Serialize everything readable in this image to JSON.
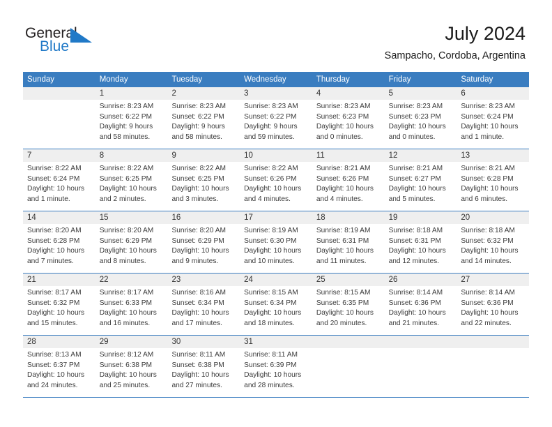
{
  "brand": {
    "name_part1": "General",
    "name_part2": "Blue",
    "accent_color": "#2079c7",
    "triangle_color": "#2079c7"
  },
  "header": {
    "title": "July 2024",
    "location": "Sampacho, Cordoba, Argentina"
  },
  "calendar": {
    "header_bg": "#3a7dc0",
    "daynum_bg": "#efefef",
    "weekday_names": [
      "Sunday",
      "Monday",
      "Tuesday",
      "Wednesday",
      "Thursday",
      "Friday",
      "Saturday"
    ],
    "weeks": [
      {
        "days": [
          {
            "num": "",
            "lines": []
          },
          {
            "num": "1",
            "lines": [
              "Sunrise: 8:23 AM",
              "Sunset: 6:22 PM",
              "Daylight: 9 hours",
              "and 58 minutes."
            ]
          },
          {
            "num": "2",
            "lines": [
              "Sunrise: 8:23 AM",
              "Sunset: 6:22 PM",
              "Daylight: 9 hours",
              "and 58 minutes."
            ]
          },
          {
            "num": "3",
            "lines": [
              "Sunrise: 8:23 AM",
              "Sunset: 6:22 PM",
              "Daylight: 9 hours",
              "and 59 minutes."
            ]
          },
          {
            "num": "4",
            "lines": [
              "Sunrise: 8:23 AM",
              "Sunset: 6:23 PM",
              "Daylight: 10 hours",
              "and 0 minutes."
            ]
          },
          {
            "num": "5",
            "lines": [
              "Sunrise: 8:23 AM",
              "Sunset: 6:23 PM",
              "Daylight: 10 hours",
              "and 0 minutes."
            ]
          },
          {
            "num": "6",
            "lines": [
              "Sunrise: 8:23 AM",
              "Sunset: 6:24 PM",
              "Daylight: 10 hours",
              "and 1 minute."
            ]
          }
        ]
      },
      {
        "days": [
          {
            "num": "7",
            "lines": [
              "Sunrise: 8:22 AM",
              "Sunset: 6:24 PM",
              "Daylight: 10 hours",
              "and 1 minute."
            ]
          },
          {
            "num": "8",
            "lines": [
              "Sunrise: 8:22 AM",
              "Sunset: 6:25 PM",
              "Daylight: 10 hours",
              "and 2 minutes."
            ]
          },
          {
            "num": "9",
            "lines": [
              "Sunrise: 8:22 AM",
              "Sunset: 6:25 PM",
              "Daylight: 10 hours",
              "and 3 minutes."
            ]
          },
          {
            "num": "10",
            "lines": [
              "Sunrise: 8:22 AM",
              "Sunset: 6:26 PM",
              "Daylight: 10 hours",
              "and 4 minutes."
            ]
          },
          {
            "num": "11",
            "lines": [
              "Sunrise: 8:21 AM",
              "Sunset: 6:26 PM",
              "Daylight: 10 hours",
              "and 4 minutes."
            ]
          },
          {
            "num": "12",
            "lines": [
              "Sunrise: 8:21 AM",
              "Sunset: 6:27 PM",
              "Daylight: 10 hours",
              "and 5 minutes."
            ]
          },
          {
            "num": "13",
            "lines": [
              "Sunrise: 8:21 AM",
              "Sunset: 6:28 PM",
              "Daylight: 10 hours",
              "and 6 minutes."
            ]
          }
        ]
      },
      {
        "days": [
          {
            "num": "14",
            "lines": [
              "Sunrise: 8:20 AM",
              "Sunset: 6:28 PM",
              "Daylight: 10 hours",
              "and 7 minutes."
            ]
          },
          {
            "num": "15",
            "lines": [
              "Sunrise: 8:20 AM",
              "Sunset: 6:29 PM",
              "Daylight: 10 hours",
              "and 8 minutes."
            ]
          },
          {
            "num": "16",
            "lines": [
              "Sunrise: 8:20 AM",
              "Sunset: 6:29 PM",
              "Daylight: 10 hours",
              "and 9 minutes."
            ]
          },
          {
            "num": "17",
            "lines": [
              "Sunrise: 8:19 AM",
              "Sunset: 6:30 PM",
              "Daylight: 10 hours",
              "and 10 minutes."
            ]
          },
          {
            "num": "18",
            "lines": [
              "Sunrise: 8:19 AM",
              "Sunset: 6:31 PM",
              "Daylight: 10 hours",
              "and 11 minutes."
            ]
          },
          {
            "num": "19",
            "lines": [
              "Sunrise: 8:18 AM",
              "Sunset: 6:31 PM",
              "Daylight: 10 hours",
              "and 12 minutes."
            ]
          },
          {
            "num": "20",
            "lines": [
              "Sunrise: 8:18 AM",
              "Sunset: 6:32 PM",
              "Daylight: 10 hours",
              "and 14 minutes."
            ]
          }
        ]
      },
      {
        "days": [
          {
            "num": "21",
            "lines": [
              "Sunrise: 8:17 AM",
              "Sunset: 6:32 PM",
              "Daylight: 10 hours",
              "and 15 minutes."
            ]
          },
          {
            "num": "22",
            "lines": [
              "Sunrise: 8:17 AM",
              "Sunset: 6:33 PM",
              "Daylight: 10 hours",
              "and 16 minutes."
            ]
          },
          {
            "num": "23",
            "lines": [
              "Sunrise: 8:16 AM",
              "Sunset: 6:34 PM",
              "Daylight: 10 hours",
              "and 17 minutes."
            ]
          },
          {
            "num": "24",
            "lines": [
              "Sunrise: 8:15 AM",
              "Sunset: 6:34 PM",
              "Daylight: 10 hours",
              "and 18 minutes."
            ]
          },
          {
            "num": "25",
            "lines": [
              "Sunrise: 8:15 AM",
              "Sunset: 6:35 PM",
              "Daylight: 10 hours",
              "and 20 minutes."
            ]
          },
          {
            "num": "26",
            "lines": [
              "Sunrise: 8:14 AM",
              "Sunset: 6:36 PM",
              "Daylight: 10 hours",
              "and 21 minutes."
            ]
          },
          {
            "num": "27",
            "lines": [
              "Sunrise: 8:14 AM",
              "Sunset: 6:36 PM",
              "Daylight: 10 hours",
              "and 22 minutes."
            ]
          }
        ]
      },
      {
        "days": [
          {
            "num": "28",
            "lines": [
              "Sunrise: 8:13 AM",
              "Sunset: 6:37 PM",
              "Daylight: 10 hours",
              "and 24 minutes."
            ]
          },
          {
            "num": "29",
            "lines": [
              "Sunrise: 8:12 AM",
              "Sunset: 6:38 PM",
              "Daylight: 10 hours",
              "and 25 minutes."
            ]
          },
          {
            "num": "30",
            "lines": [
              "Sunrise: 8:11 AM",
              "Sunset: 6:38 PM",
              "Daylight: 10 hours",
              "and 27 minutes."
            ]
          },
          {
            "num": "31",
            "lines": [
              "Sunrise: 8:11 AM",
              "Sunset: 6:39 PM",
              "Daylight: 10 hours",
              "and 28 minutes."
            ]
          },
          {
            "num": "",
            "lines": []
          },
          {
            "num": "",
            "lines": []
          },
          {
            "num": "",
            "lines": []
          }
        ]
      }
    ]
  }
}
